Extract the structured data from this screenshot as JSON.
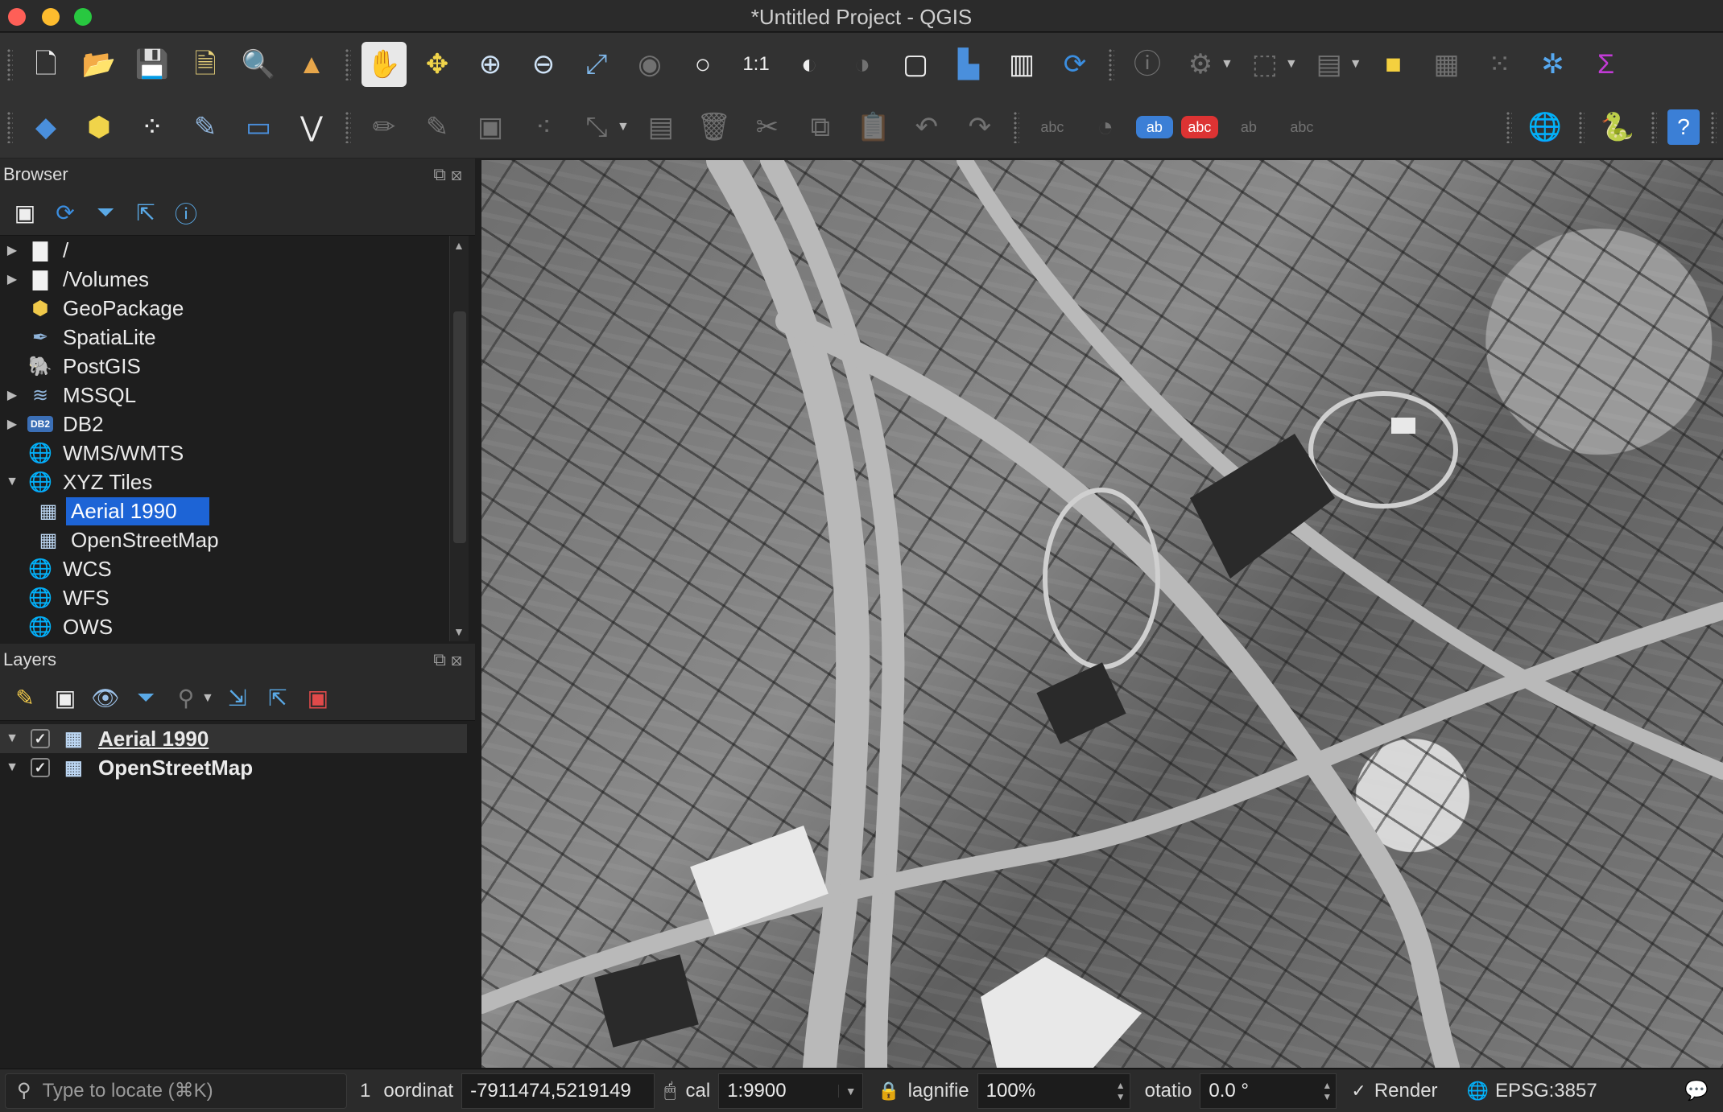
{
  "window": {
    "title": "*Untitled Project - QGIS"
  },
  "toolbar1": {
    "icons": [
      "new-project",
      "open-project",
      "save-project",
      "new-print-layout",
      "layout-manager",
      "style-manager",
      "pan-map",
      "pan-to-selection",
      "zoom-in",
      "zoom-out",
      "zoom-full",
      "zoom-to-selection",
      "zoom-to-layer",
      "zoom-native",
      "zoom-last",
      "zoom-next",
      "new-bookmark",
      "show-bookmarks",
      "new-map-view",
      "refresh",
      "identify",
      "actions",
      "select-features",
      "attribute-table-select",
      "deselect-all",
      "open-attribute-table",
      "statistics",
      "toolbox",
      "sum"
    ]
  },
  "toolbar2": {
    "icons": [
      "data-source-manager",
      "new-geopackage-layer",
      "new-temp-scratch-layer",
      "new-spatialite-layer",
      "new-virtual-layer",
      "digitize-vertex",
      "current-edits",
      "toggle-editing",
      "save-edits",
      "add-feature",
      "vertex-tool",
      "modify-attributes",
      "delete-selected",
      "cut-features",
      "copy-features",
      "paste-features",
      "undo",
      "redo",
      "label-tool",
      "diagram-tool",
      "label-pin",
      "label-show-hide",
      "label-move",
      "label-rotate",
      "metasearch",
      "python-console",
      "help"
    ]
  },
  "browser": {
    "title": "Browser",
    "items": [
      {
        "label": "/",
        "icon": "folder",
        "expandable": true
      },
      {
        "label": "/Volumes",
        "icon": "folder",
        "expandable": true
      },
      {
        "label": "GeoPackage",
        "icon": "geopackage",
        "expandable": false
      },
      {
        "label": "SpatiaLite",
        "icon": "spatialite",
        "expandable": false
      },
      {
        "label": "PostGIS",
        "icon": "postgis",
        "expandable": false
      },
      {
        "label": "MSSQL",
        "icon": "mssql",
        "expandable": true
      },
      {
        "label": "DB2",
        "icon": "db2",
        "expandable": true
      },
      {
        "label": "WMS/WMTS",
        "icon": "globe",
        "expandable": false
      },
      {
        "label": "XYZ Tiles",
        "icon": "globe",
        "expandable": true,
        "expanded": true
      },
      {
        "label": "Aerial 1990",
        "icon": "xyz-tile",
        "child": true,
        "selected": true
      },
      {
        "label": "OpenStreetMap",
        "icon": "xyz-tile",
        "child": true
      },
      {
        "label": "WCS",
        "icon": "globe",
        "expandable": false
      },
      {
        "label": "WFS",
        "icon": "globe",
        "expandable": false
      },
      {
        "label": "OWS",
        "icon": "globe",
        "expandable": false
      }
    ],
    "db2_badge": "DB2"
  },
  "layers": {
    "title": "Layers",
    "items": [
      {
        "label": "Aerial 1990",
        "checked": true,
        "active": true
      },
      {
        "label": "OpenStreetMap",
        "checked": true,
        "active": false
      }
    ]
  },
  "status": {
    "locator_placeholder": "Type to locate (⌘K)",
    "coord_prefix": "1",
    "coordinate_label": "oordinat",
    "coordinate_value": "-7911474,5219149",
    "scale_label": "cal",
    "scale_value": "1:9900",
    "magnifier_label": "lagnifie",
    "magnifier_value": "100%",
    "rotation_label": "otatio",
    "rotation_value": "0.0 °",
    "render_label": "Render",
    "render_checked": true,
    "crs": "EPSG:3857"
  },
  "colors": {
    "selection": "#1d64d6",
    "panel_bg": "#1e1e1e",
    "toolbar_bg": "#323232"
  }
}
